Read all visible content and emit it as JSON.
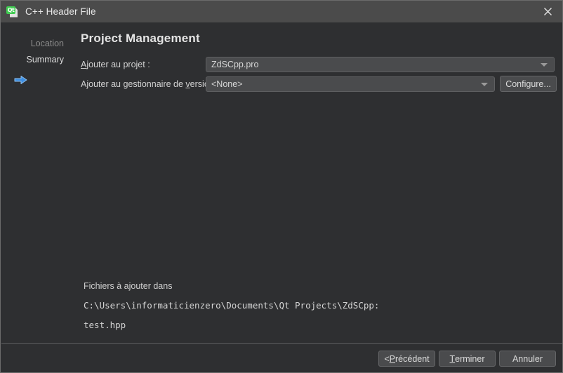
{
  "window": {
    "title": "C++ Header File",
    "icon": "qt-header-file-icon",
    "close_icon": "close-icon",
    "background_color": "#2e2f31",
    "titlebar_color": "#4b4b4b",
    "accent_color": "#41cd52"
  },
  "sidebar": {
    "items": [
      {
        "label": "Location",
        "active": false,
        "icon": null
      },
      {
        "label": "Summary",
        "active": true,
        "icon": "blue-right-arrow-icon"
      }
    ]
  },
  "main": {
    "title": "Project Management",
    "fields": [
      {
        "label_prefix": "",
        "label_accel": "A",
        "label_suffix": "jouter au projet :",
        "control": "combobox",
        "value": "ZdSCpp.pro"
      },
      {
        "label_prefix": "Ajouter au gestionnaire de ",
        "label_accel": "v",
        "label_suffix": "ersion :",
        "control": "combobox",
        "value": "<None>"
      }
    ],
    "configure_button": {
      "label": "Configure...",
      "icon": "gear-settings-action"
    },
    "files_section": {
      "heading": "Fichiers à ajouter dans",
      "path": "C:\\Users\\informaticienzero\\Documents\\Qt Projects\\ZdSCpp:",
      "files": [
        "test.hpp"
      ]
    }
  },
  "footer": {
    "buttons": [
      {
        "prefix": "< ",
        "accel": "P",
        "suffix": "récédent",
        "name": "back"
      },
      {
        "prefix": "",
        "accel": "T",
        "suffix": "erminer",
        "name": "finish"
      },
      {
        "prefix": "Annuler",
        "accel": "",
        "suffix": "",
        "name": "cancel"
      }
    ]
  }
}
